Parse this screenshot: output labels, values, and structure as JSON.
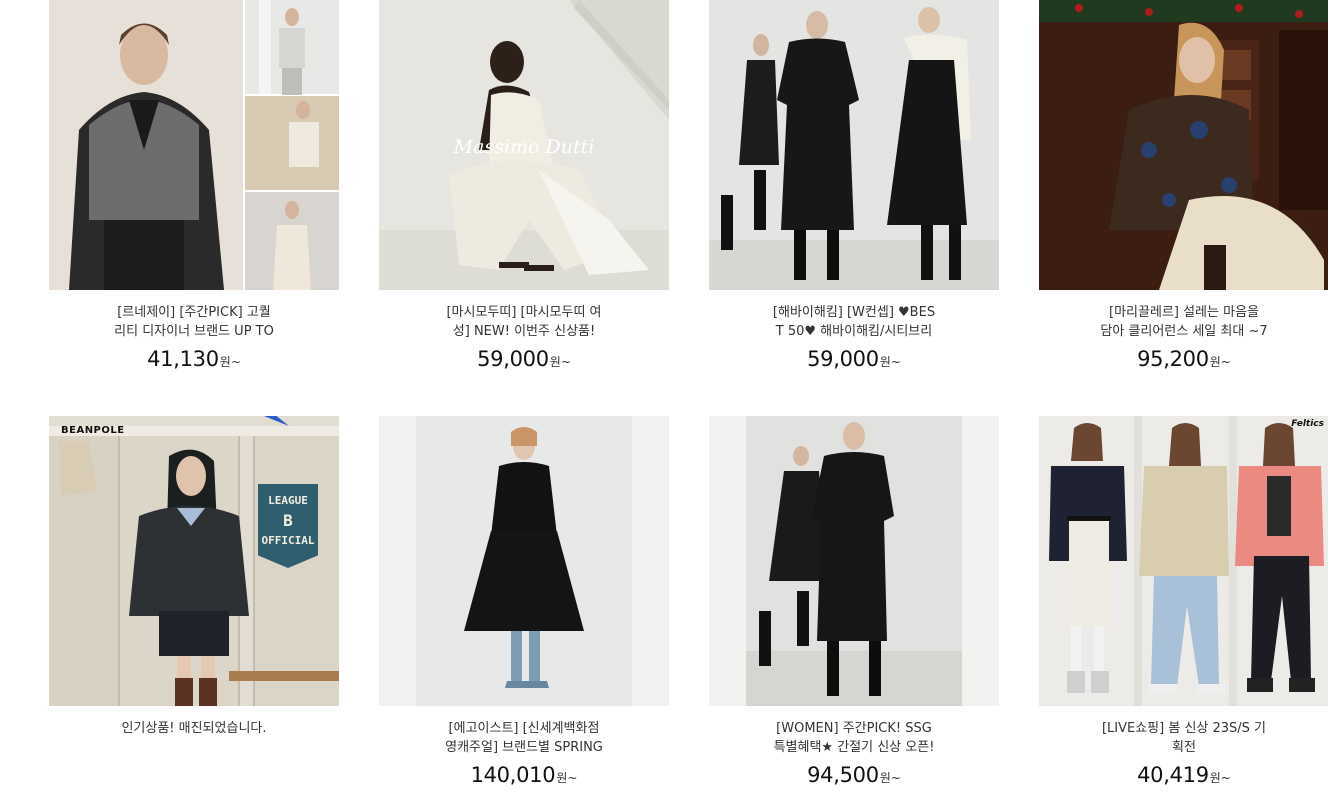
{
  "products": [
    {
      "title_line1": "[르네제이] [주간PICK] 고퀄",
      "title_line2": "리티 디자이너 브랜드 UP TO",
      "price": "41,130",
      "unit": "원~"
    },
    {
      "title_line1": "[마시모두띠] [마시모두띠 여",
      "title_line2": "성] NEW! 이번주 신상품!",
      "price": "59,000",
      "unit": "원~",
      "logo_text": "Massimo Dutti"
    },
    {
      "title_line1": "[해바이해킴] [W컨셉] ♥BES",
      "title_line2": "T 50♥ 해바이해킴/시티브리",
      "price": "59,000",
      "unit": "원~"
    },
    {
      "title_line1": "[마리끌레르] 설레는 마음을",
      "title_line2": "담아 클리어런스 세일 최대 ~7",
      "price": "95,200",
      "unit": "원~"
    },
    {
      "title_line1": "인기상품! 매진되었습니다.",
      "title_line2": "",
      "price": "",
      "unit": "",
      "brand_text": "BEANPOLE",
      "banner_line1": "LEAGUE",
      "banner_line2": "B",
      "banner_line3": "OFFICIAL"
    },
    {
      "title_line1": "[에고이스트] [신세계백화점",
      "title_line2": "영캐주얼] 브랜드별 SPRING",
      "price": "140,010",
      "unit": "원~"
    },
    {
      "title_line1": "[WOMEN] 주간PICK! SSG",
      "title_line2": "특별혜택★ 간절기 신상 오픈!",
      "price": "94,500",
      "unit": "원~"
    },
    {
      "title_line1": "[LIVE쇼핑] 봄 신상 23S/S 기",
      "title_line2": "획전",
      "price": "40,419",
      "unit": "원~",
      "brand_text": "Feltics"
    }
  ],
  "colors": {
    "price_text": "#111111",
    "title_text": "#333333",
    "banner_teal": "#2f5f6f"
  }
}
